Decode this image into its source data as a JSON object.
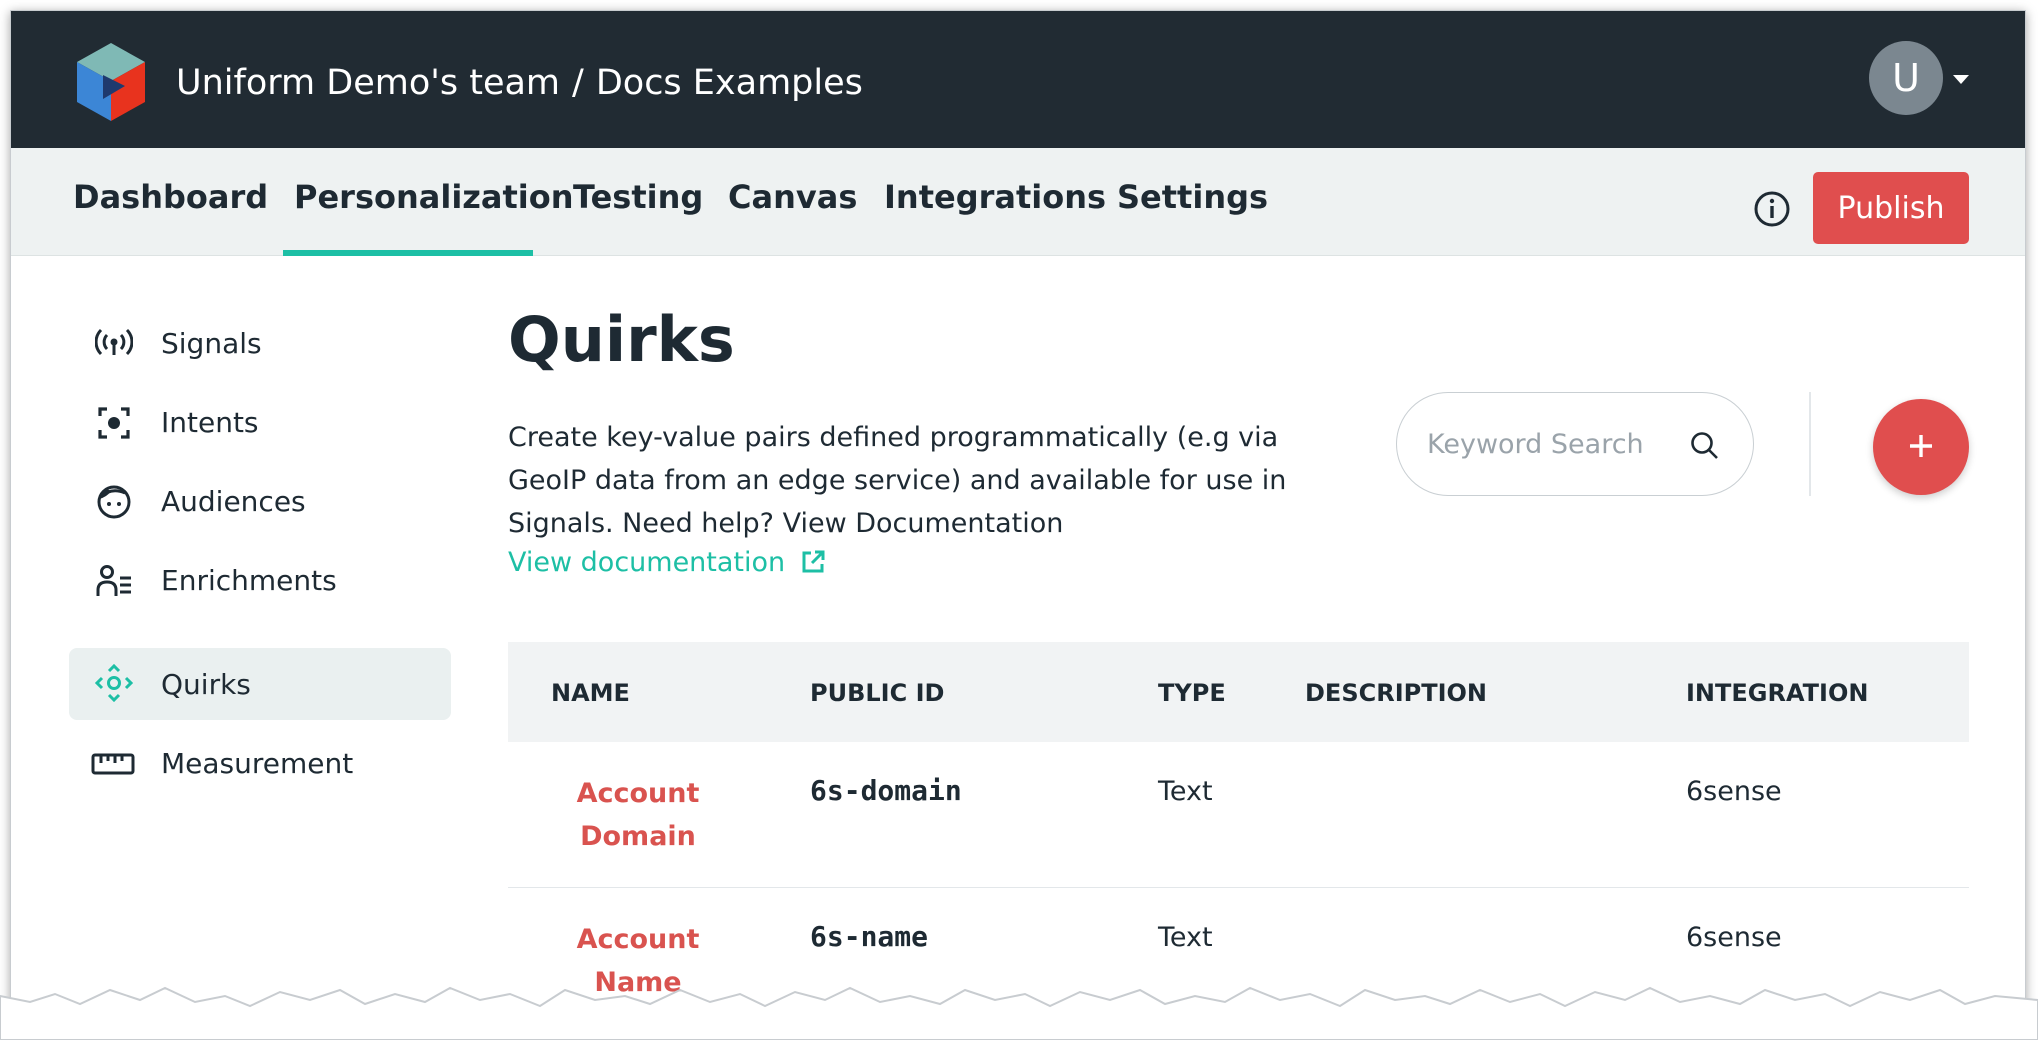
{
  "topbar": {
    "team": "Uniform Demo's team",
    "separator": "/",
    "project": "Docs Examples",
    "avatar_initial": "U"
  },
  "nav": {
    "tabs": [
      {
        "label": "Dashboard"
      },
      {
        "label": "Personalization",
        "active": true
      },
      {
        "label": "Testing"
      },
      {
        "label": "Canvas"
      },
      {
        "label": "Integrations"
      },
      {
        "label": "Settings"
      }
    ],
    "publish_label": "Publish"
  },
  "sidebar": {
    "items": [
      {
        "label": "Signals",
        "icon": "signal-broadcast-icon"
      },
      {
        "label": "Intents",
        "icon": "target-focus-icon"
      },
      {
        "label": "Audiences",
        "icon": "face-icon"
      },
      {
        "label": "Enrichments",
        "icon": "user-list-icon"
      },
      {
        "label": "Quirks",
        "icon": "quirk-move-icon",
        "active": true
      },
      {
        "label": "Measurement",
        "icon": "ruler-icon"
      }
    ]
  },
  "main": {
    "title": "Quirks",
    "description": "Create key-value pairs defined programmatically (e.g via GeoIP data from an edge service) and available for use in Signals. Need help? View Documentation",
    "doc_link": "View documentation",
    "search_placeholder": "Keyword Search"
  },
  "table": {
    "headers": [
      "NAME",
      "PUBLIC ID",
      "TYPE",
      "DESCRIPTION",
      "INTEGRATION"
    ],
    "rows": [
      {
        "name": "Account Domain",
        "public_id": "6s-domain",
        "type": "Text",
        "description": "",
        "integration": "6sense"
      },
      {
        "name": "Account Name",
        "public_id": "6s-name",
        "type": "Text",
        "description": "",
        "integration": "6sense"
      }
    ]
  },
  "colors": {
    "topbar_bg": "#212b33",
    "accent_teal": "#1dbfa5",
    "accent_red": "#e04e4e",
    "nav_bg": "#eef2f2"
  }
}
